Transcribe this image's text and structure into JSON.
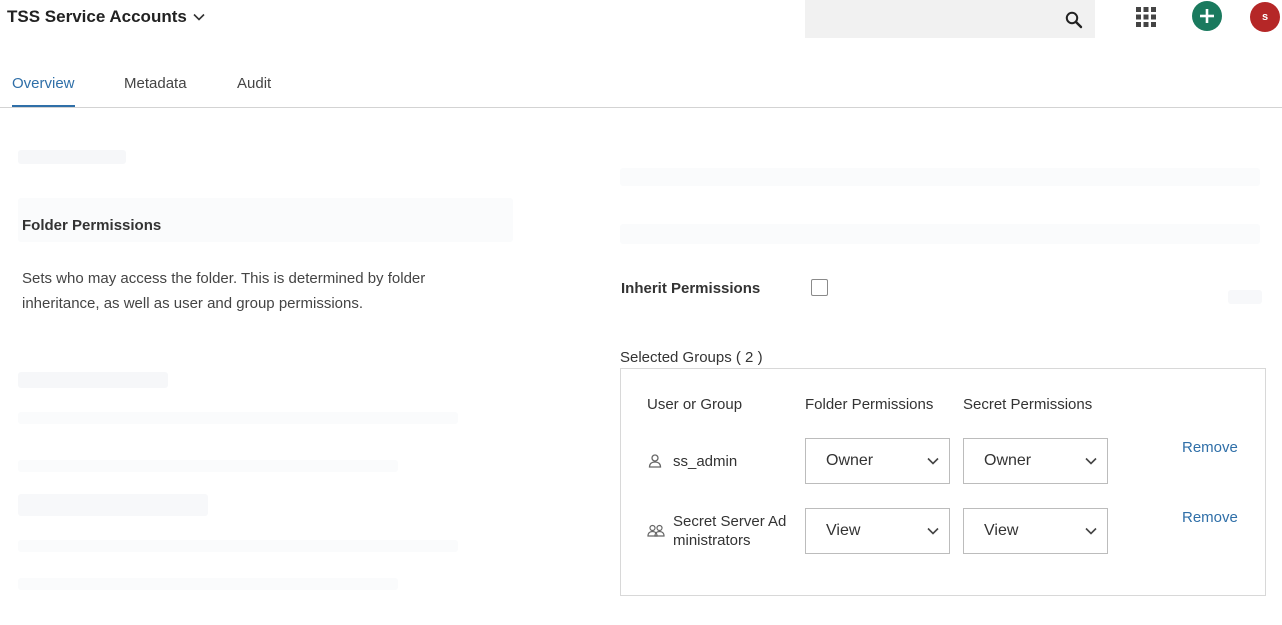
{
  "header": {
    "title": "TSS Service Accounts",
    "search_placeholder": "",
    "avatar_initial": "s"
  },
  "tabs": [
    {
      "label": "Overview",
      "active": true
    },
    {
      "label": "Metadata",
      "active": false
    },
    {
      "label": "Audit",
      "active": false
    }
  ],
  "section": {
    "title": "Folder Permissions",
    "description": "Sets who may access the folder. This is determined by folder inheritance, as well as user and group permissions."
  },
  "inherit": {
    "label": "Inherit Permissions",
    "checked": false
  },
  "groups": {
    "label": "Selected Groups ( 2 )",
    "columns": [
      "User or Group",
      "Folder Permissions",
      "Secret Permissions"
    ],
    "rows": [
      {
        "icon": "user-icon",
        "name": "ss_admin",
        "folder_permission": "Owner",
        "secret_permission": "Owner",
        "action": "Remove"
      },
      {
        "icon": "group-icon",
        "name_line1": "Secret Server Ad",
        "name_line2": "ministrators",
        "folder_permission": "View",
        "secret_permission": "View",
        "action": "Remove"
      }
    ]
  },
  "colors": {
    "accent": "#2f6fa8",
    "add_button": "#1a7a5e",
    "avatar": "#b52727"
  }
}
